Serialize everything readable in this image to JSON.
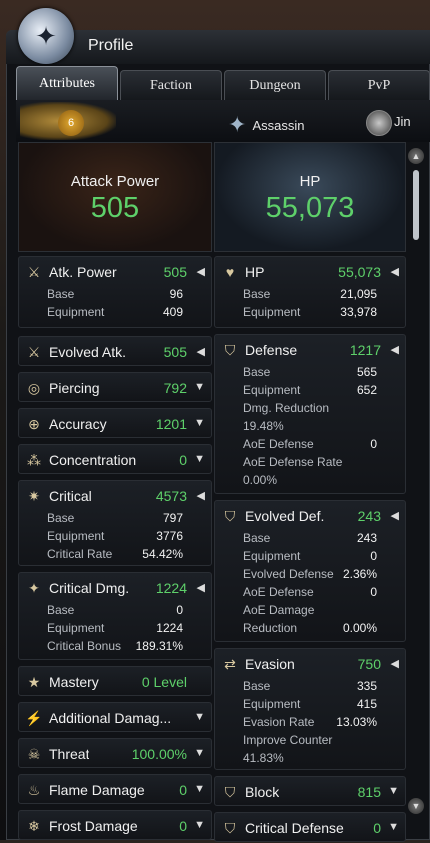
{
  "window": {
    "title": "Profile"
  },
  "tabs": [
    "Attributes",
    "Faction",
    "Dungeon",
    "PvP"
  ],
  "character": {
    "level": "6",
    "class": "Assassin",
    "race": "Jin"
  },
  "summary": {
    "attack_label": "Attack Power",
    "attack_value": "505",
    "hp_label": "HP",
    "hp_value": "55,073"
  },
  "left_stats": [
    {
      "icon": "swords-icon",
      "name": "Atk. Power",
      "value": "505",
      "arrow": "◀",
      "rows": [
        [
          "Base",
          "96"
        ],
        [
          "Equipment",
          "409"
        ]
      ]
    },
    {
      "icon": "evolved-sword-icon",
      "name": "Evolved Atk.",
      "value": "505",
      "arrow": "◀",
      "rows": []
    },
    {
      "icon": "piercing-icon",
      "name": "Piercing",
      "value": "792",
      "arrow": "▼",
      "rows": []
    },
    {
      "icon": "accuracy-icon",
      "name": "Accuracy",
      "value": "1201",
      "arrow": "▼",
      "rows": []
    },
    {
      "icon": "concentration-icon",
      "name": "Concentration",
      "value": "0",
      "arrow": "▼",
      "rows": []
    },
    {
      "icon": "critical-icon",
      "name": "Critical",
      "value": "4573",
      "arrow": "◀",
      "rows": [
        [
          "Base",
          "797"
        ],
        [
          "Equipment",
          "3776"
        ],
        [
          "Critical Rate",
          "54.42%"
        ]
      ]
    },
    {
      "icon": "critical-damage-icon",
      "name": "Critical Dmg.",
      "value": "1224",
      "arrow": "◀",
      "rows": [
        [
          "Base",
          "0"
        ],
        [
          "Equipment",
          "1224"
        ],
        [
          "Critical Bonus",
          "189.31%"
        ]
      ]
    },
    {
      "icon": "mastery-icon",
      "name": "Mastery",
      "value": "0 Level",
      "arrow": "",
      "rows": []
    },
    {
      "icon": "additional-damage-icon",
      "name": "Additional Damag...",
      "value": "",
      "arrow": "▼",
      "rows": []
    },
    {
      "icon": "threat-icon",
      "name": "Threat",
      "value": "100.00%",
      "arrow": "▼",
      "rows": []
    },
    {
      "icon": "flame-icon",
      "name": "Flame Damage",
      "value": "0",
      "arrow": "▼",
      "rows": []
    },
    {
      "icon": "frost-icon",
      "name": "Frost Damage",
      "value": "0",
      "arrow": "▼",
      "rows": []
    }
  ],
  "right_stats": [
    {
      "icon": "heart-icon",
      "name": "HP",
      "value": "55,073",
      "arrow": "◀",
      "rows": [
        [
          "Base",
          "21,095"
        ],
        [
          "Equipment",
          "33,978"
        ]
      ]
    },
    {
      "icon": "shield-icon",
      "name": "Defense",
      "value": "1217",
      "arrow": "◀",
      "rows": [
        [
          "Base",
          "565"
        ],
        [
          "Equipment",
          "652"
        ],
        [
          "Dmg. Reduction",
          ""
        ],
        [
          "19.48%",
          ""
        ],
        [
          "AoE Defense",
          "0"
        ],
        [
          "AoE Defense Rate",
          ""
        ],
        [
          "0.00%",
          ""
        ]
      ]
    },
    {
      "icon": "evolved-shield-icon",
      "name": "Evolved Def.",
      "value": "243",
      "arrow": "◀",
      "rows": [
        [
          "Base",
          "243"
        ],
        [
          "Equipment",
          "0"
        ],
        [
          "Evolved Defense",
          "2.36%"
        ],
        [
          "AoE Defense",
          "0"
        ],
        [
          "AoE Damage",
          ""
        ],
        [
          "Reduction",
          "0.00%"
        ]
      ]
    },
    {
      "icon": "evasion-icon",
      "name": "Evasion",
      "value": "750",
      "arrow": "◀",
      "rows": [
        [
          "Base",
          "335"
        ],
        [
          "Equipment",
          "415"
        ],
        [
          "Evasion Rate",
          "13.03%"
        ],
        [
          "Improve Counter",
          ""
        ],
        [
          "41.83%",
          ""
        ]
      ]
    },
    {
      "icon": "block-icon",
      "name": "Block",
      "value": "815",
      "arrow": "▼",
      "rows": []
    },
    {
      "icon": "critical-defense-icon",
      "name": "Critical Defense",
      "value": "0",
      "arrow": "▼",
      "rows": []
    }
  ],
  "colors": {
    "value_green": "#5ed06a",
    "panel_bg": "#101216"
  }
}
